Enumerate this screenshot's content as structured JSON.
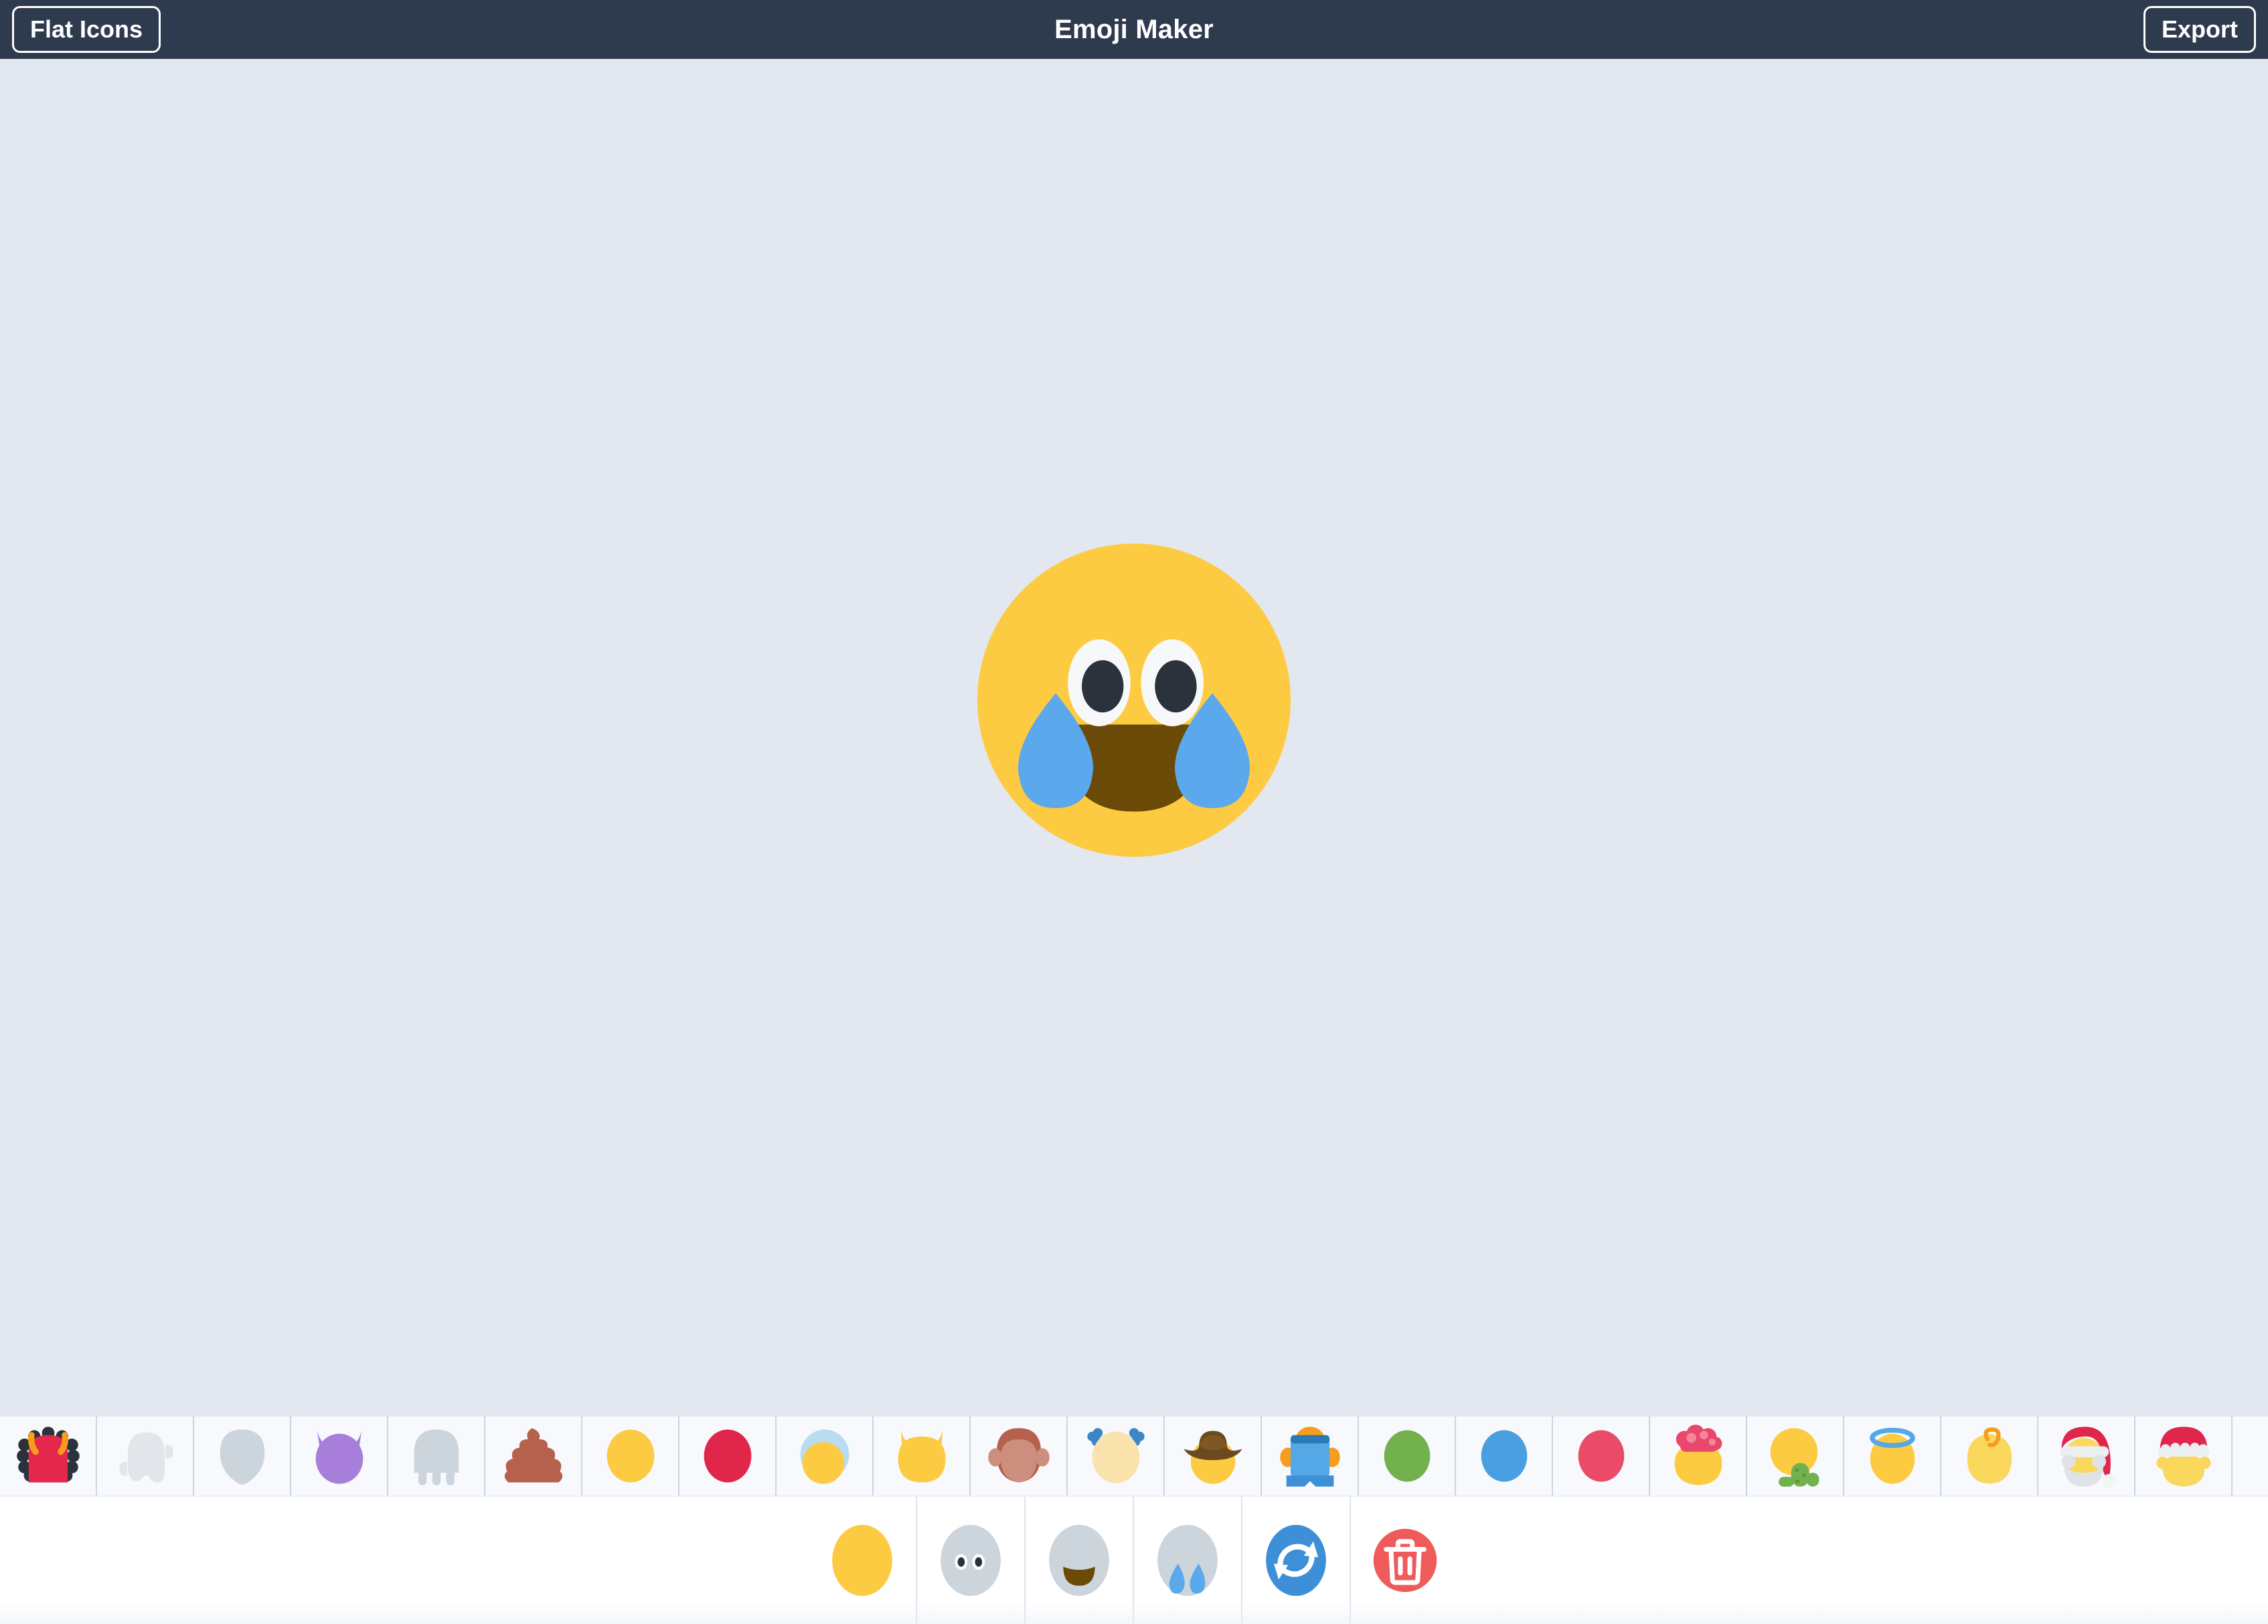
{
  "header": {
    "left_button_label": "Flat Icons",
    "title": "Emoji Maker",
    "right_button_label": "Export",
    "background_color": "#2e3a4e",
    "text_color": "#ffffff"
  },
  "canvas": {
    "background_color": "#e2e7f0",
    "current_emoji": {
      "name": "smiling-face-with-tears-of-joy",
      "base": {
        "icon": "circle-face-base",
        "color": "#fdcb42",
        "shape": "circle"
      },
      "eyes": {
        "icon": "wide-oval-eyes",
        "sclera_color": "#f7f8fa",
        "pupil_color": "#2b323c",
        "count": 2
      },
      "mouth": {
        "icon": "open-smile-mouth",
        "color": "#6a4a06"
      },
      "extras": {
        "icon": "tear-drops",
        "color": "#5ba8ec",
        "count": 2,
        "position": "both-cheeks"
      }
    }
  },
  "palette": {
    "background_color": "#f7f9fc",
    "divider_color": "#ccd4e2",
    "scrollable": true,
    "items": [
      {
        "name": "monster-base",
        "label": "Monster",
        "colors": {
          "body": "#e5274b",
          "spikes": "#2b323c",
          "horns": "#f79c1d"
        }
      },
      {
        "name": "ghost-base",
        "label": "Ghost",
        "colors": {
          "body": "#e2e6ea"
        }
      },
      {
        "name": "balloon-base",
        "label": "Balloon",
        "colors": {
          "body": "#ccd4dc"
        }
      },
      {
        "name": "devil-base",
        "label": "Devil",
        "colors": {
          "body": "#a77fda"
        }
      },
      {
        "name": "alien-base",
        "label": "Alien",
        "colors": {
          "body": "#ccd4dc"
        }
      },
      {
        "name": "poop-base",
        "label": "Poop",
        "colors": {
          "body": "#b5614d"
        }
      },
      {
        "name": "yellow-face-base",
        "label": "Yellow Face",
        "colors": {
          "body": "#fdcb42"
        }
      },
      {
        "name": "red-face-base",
        "label": "Red Face",
        "colors": {
          "body": "#e0264b"
        }
      },
      {
        "name": "snow-cap-face-base",
        "label": "Snow Cap Face",
        "colors": {
          "body": "#fdcb42",
          "cap": "#b8dcf2"
        }
      },
      {
        "name": "cat-face-base",
        "label": "Cat Face",
        "colors": {
          "body": "#fdcb42"
        }
      },
      {
        "name": "monkey-face-base",
        "label": "Monkey Face",
        "colors": {
          "body": "#b5614d",
          "muzzle": "#cc8f7d"
        }
      },
      {
        "name": "pigtails-face-base",
        "label": "Pigtails Face",
        "colors": {
          "body": "#fbe3ad",
          "bows": "#3a86c8"
        }
      },
      {
        "name": "cowboy-face-base",
        "label": "Cowboy Face",
        "colors": {
          "body": "#fdcb42",
          "hat": "#6b4a1e"
        }
      },
      {
        "name": "robot-face-base",
        "label": "Robot Face",
        "colors": {
          "body": "#55a8e6",
          "trim": "#2b7ab5",
          "ears": "#f79c1d"
        }
      },
      {
        "name": "green-face-base",
        "label": "Green Face",
        "colors": {
          "body": "#73b14e"
        }
      },
      {
        "name": "blue-face-base",
        "label": "Blue Face",
        "colors": {
          "body": "#4a9fe0"
        }
      },
      {
        "name": "pink-face-base",
        "label": "Pink Face",
        "colors": {
          "body": "#e94b68"
        }
      },
      {
        "name": "brain-face-base",
        "label": "Brain Face",
        "colors": {
          "body": "#fdcb42",
          "brain": "#e8486b"
        }
      },
      {
        "name": "cactus-face-base",
        "label": "Cactus Face",
        "colors": {
          "body": "#fdcb42",
          "cactus": "#73b14e"
        }
      },
      {
        "name": "angel-face-base",
        "label": "Angel Face",
        "colors": {
          "body": "#fdcb42",
          "halo": "#55a8e6"
        }
      },
      {
        "name": "curl-face-base",
        "label": "Curl Face",
        "colors": {
          "body": "#fad85e",
          "curl": "#f79c1d"
        }
      },
      {
        "name": "santa-face-base",
        "label": "Santa Face",
        "colors": {
          "body": "#fad85e",
          "hat": "#e0264b",
          "beard": "#dfe3e7"
        }
      },
      {
        "name": "santa-hat-face-base",
        "label": "Santa Hat Face",
        "colors": {
          "body": "#fad85e",
          "hat": "#e0264b",
          "trim": "#eceff2"
        }
      }
    ]
  },
  "toolbar": {
    "background_color": "#ffffff",
    "divider_color": "#dde3ed",
    "buttons": [
      {
        "name": "base-layer-button",
        "label": "Base",
        "icon": "yellow-circle",
        "color": "#fdcb42",
        "selected": true
      },
      {
        "name": "eyes-layer-button",
        "label": "Eyes",
        "icon": "eyes",
        "color": "#ccd4dc"
      },
      {
        "name": "mouth-layer-button",
        "label": "Mouth",
        "icon": "mouth",
        "color": "#ccd4dc"
      },
      {
        "name": "extras-layer-button",
        "label": "Extras",
        "icon": "tears",
        "color": "#ccd4dc"
      },
      {
        "name": "shuffle-button",
        "label": "Shuffle",
        "icon": "refresh-icon",
        "color": "#3d8fd8"
      },
      {
        "name": "delete-button",
        "label": "Delete",
        "icon": "trash-icon",
        "color": "#ef5b5b"
      }
    ]
  }
}
